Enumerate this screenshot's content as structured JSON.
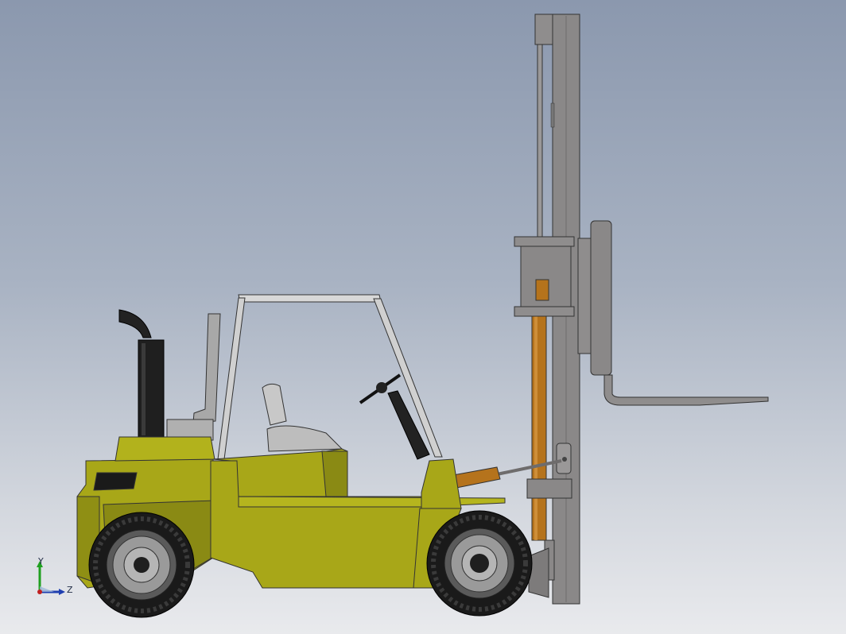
{
  "viewport": {
    "background_top": "#8b98ae",
    "background_bottom": "#e9eaed"
  },
  "model": {
    "body_color": "#a8a718",
    "body_shade": "#8a8a14",
    "mast_color": "#8a8888",
    "cylinder_color": "#b5731c",
    "tire_color": "#1a1a1a",
    "rim_color": "#9a9a9a"
  },
  "triad": {
    "y_label": "Y",
    "z_label": "Z",
    "y_color": "#1fa01f",
    "z_color": "#1f3fb0",
    "origin_color": "#c02020"
  }
}
